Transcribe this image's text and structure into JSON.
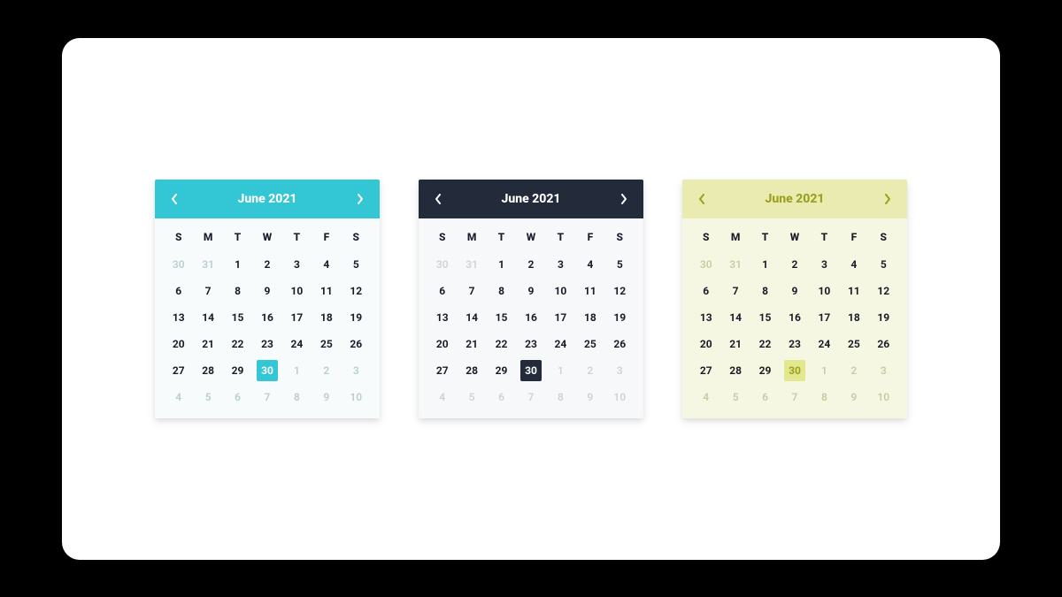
{
  "dow": [
    "S",
    "M",
    "T",
    "W",
    "T",
    "F",
    "S"
  ],
  "calendars": [
    {
      "theme": "cyan",
      "title": "June 2021",
      "selected_day": 30
    },
    {
      "theme": "dark",
      "title": "June 2021",
      "selected_day": 30
    },
    {
      "theme": "olive",
      "title": "June 2021",
      "selected_day": 30
    }
  ],
  "grid_days": [
    {
      "n": 30,
      "outside": true
    },
    {
      "n": 31,
      "outside": true
    },
    {
      "n": 1
    },
    {
      "n": 2
    },
    {
      "n": 3
    },
    {
      "n": 4
    },
    {
      "n": 5
    },
    {
      "n": 6
    },
    {
      "n": 7
    },
    {
      "n": 8
    },
    {
      "n": 9
    },
    {
      "n": 10
    },
    {
      "n": 11
    },
    {
      "n": 12
    },
    {
      "n": 13
    },
    {
      "n": 14
    },
    {
      "n": 15
    },
    {
      "n": 16
    },
    {
      "n": 17
    },
    {
      "n": 18
    },
    {
      "n": 19
    },
    {
      "n": 20
    },
    {
      "n": 21
    },
    {
      "n": 22
    },
    {
      "n": 23
    },
    {
      "n": 24
    },
    {
      "n": 25
    },
    {
      "n": 26
    },
    {
      "n": 27
    },
    {
      "n": 28
    },
    {
      "n": 29
    },
    {
      "n": 30
    },
    {
      "n": 1,
      "outside": true
    },
    {
      "n": 2,
      "outside": true
    },
    {
      "n": 3,
      "outside": true
    },
    {
      "n": 4,
      "outside": true
    },
    {
      "n": 5,
      "outside": true
    },
    {
      "n": 6,
      "outside": true
    },
    {
      "n": 7,
      "outside": true
    },
    {
      "n": 8,
      "outside": true
    },
    {
      "n": 9,
      "outside": true
    },
    {
      "n": 10,
      "outside": true
    }
  ]
}
